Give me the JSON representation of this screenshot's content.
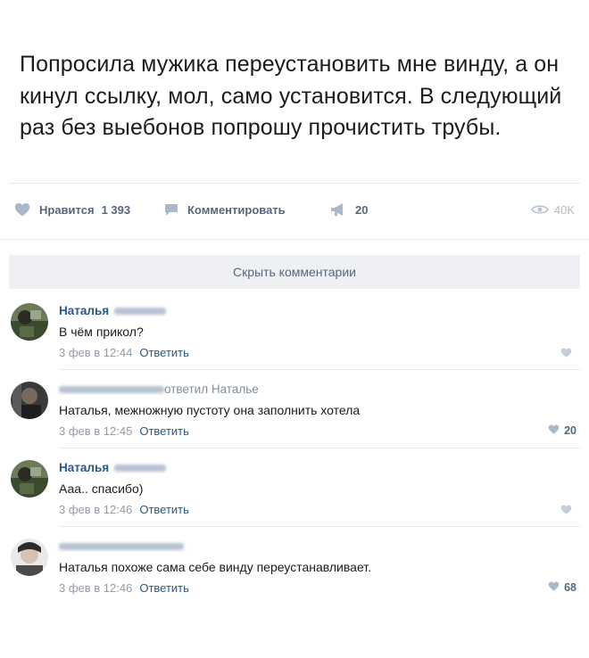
{
  "post": {
    "text": "Попросила мужика переустановить мне винду, а он кинул ссылку, мол, само установится. В следующий раз без выебонов попрошу прочистить трубы.",
    "actions": {
      "like_label": "Нравится",
      "like_count": "1 393",
      "comment_label": "Комментировать",
      "share_count": "20",
      "views": "40K"
    }
  },
  "comments_toggle": "Скрыть комментарии",
  "comments": [
    {
      "author": "Наталья",
      "replied_to": "",
      "text": "В чём прикол?",
      "date": "3 фев в 12:44",
      "reply_label": "Ответить",
      "likes": ""
    },
    {
      "author": "",
      "replied_to": "ответил Наталье",
      "text": "Наталья, межножную пустоту она заполнить хотела",
      "date": "3 фев в 12:45",
      "reply_label": "Ответить",
      "likes": "20"
    },
    {
      "author": "Наталья",
      "replied_to": "",
      "text": "Ааа.. спасибо)",
      "date": "3 фев в 12:46",
      "reply_label": "Ответить",
      "likes": ""
    },
    {
      "author": "",
      "replied_to": "",
      "text": "Наталья похоже сама себе винду переустанавливает.",
      "date": "3 фев в 12:46",
      "reply_label": "Ответить",
      "likes": "68"
    }
  ],
  "colors": {
    "link": "#2a5885",
    "action": "#55677d",
    "muted": "#939ba6",
    "hide_bar_bg": "#eef0f3"
  },
  "icons": {
    "like": "heart-icon",
    "comment": "comment-bubble-icon",
    "share": "megaphone-icon",
    "views": "eye-icon"
  }
}
